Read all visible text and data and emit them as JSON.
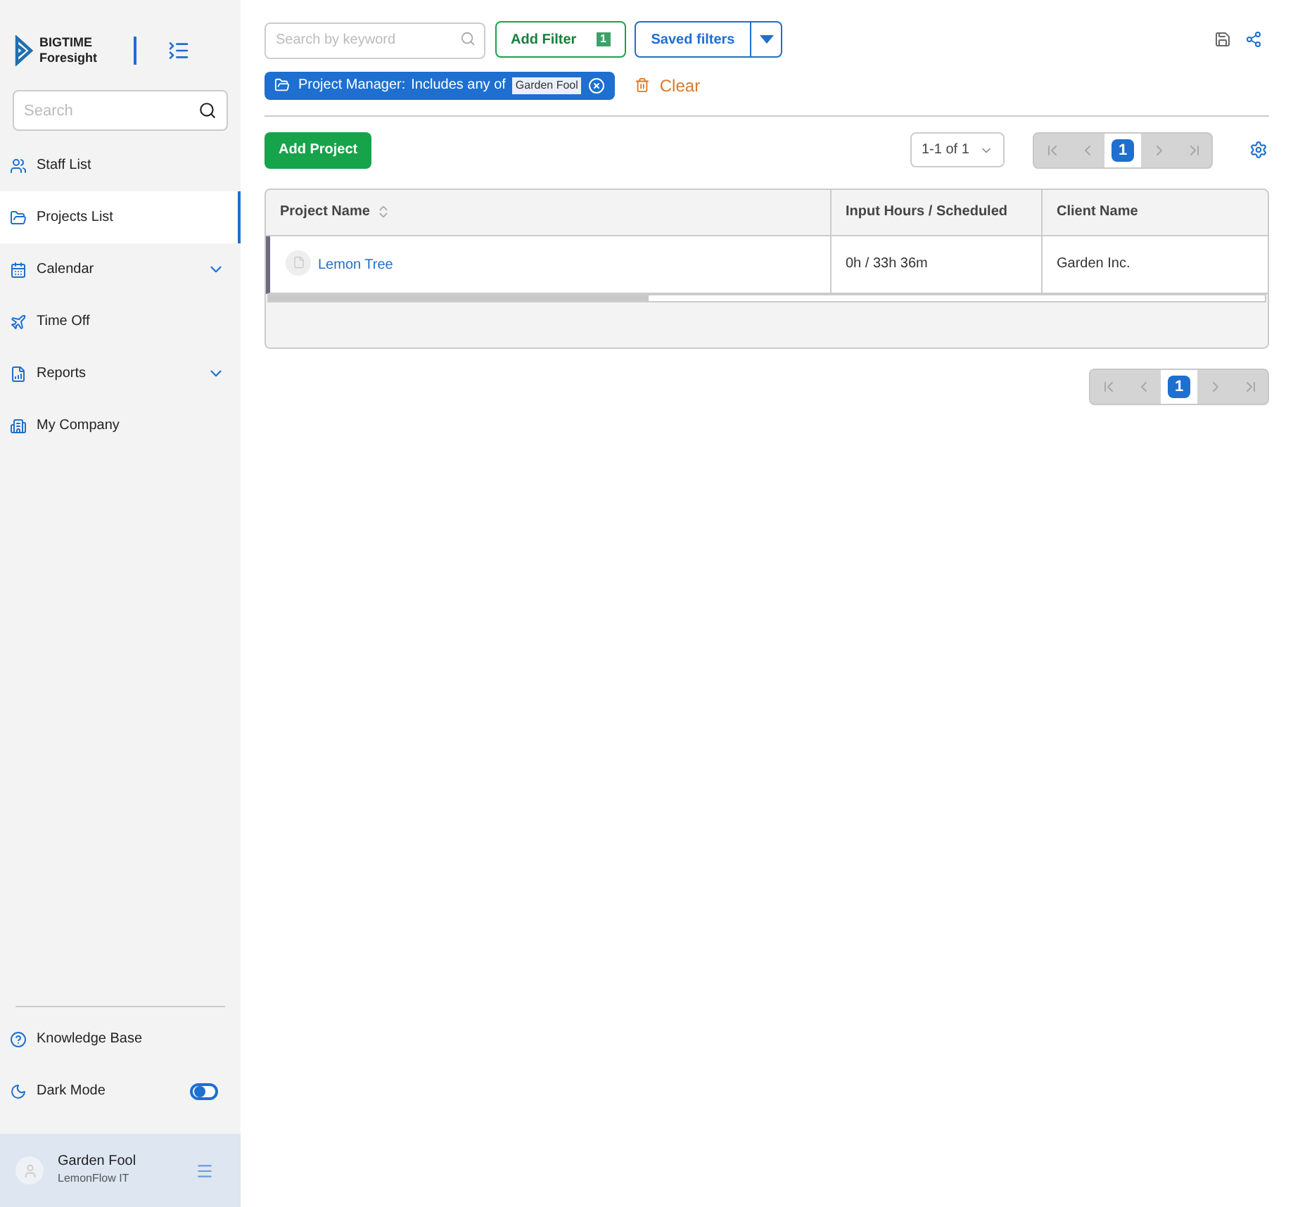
{
  "brand": {
    "line1": "BIGTIME",
    "line2": "Foresight"
  },
  "sidebar": {
    "search": {
      "placeholder": "Search"
    },
    "items": [
      {
        "label": "Staff List",
        "kind": "link",
        "selected": false
      },
      {
        "label": "Projects List",
        "kind": "link",
        "selected": true
      },
      {
        "label": "Calendar",
        "kind": "group",
        "selected": false
      },
      {
        "label": "Time Off",
        "kind": "link",
        "selected": false
      },
      {
        "label": "Reports",
        "kind": "group",
        "selected": false
      },
      {
        "label": "My Company",
        "kind": "link",
        "selected": false
      }
    ],
    "knowledge_base": "Knowledge Base",
    "dark_mode": {
      "label": "Dark Mode",
      "on": false
    },
    "user": {
      "name": "Garden Fool",
      "company": "LemonFlow IT"
    }
  },
  "toolbar": {
    "search": {
      "placeholder": "Search by keyword"
    },
    "add_filter": "Add Filter",
    "filter_count": "1",
    "saved_filters": "Saved filters"
  },
  "active_filter": {
    "field": "Project Manager:",
    "operator": "Includes any of",
    "value": "Garden Fool"
  },
  "clear": "Clear",
  "add_project": "Add Project",
  "range": "1-1 of 1",
  "pagers": [
    {
      "pages": [
        {
          "label": "1",
          "selected": true
        }
      ]
    },
    {
      "pages": [
        {
          "label": "1",
          "selected": true
        }
      ]
    }
  ],
  "table": {
    "columns": [
      "Project Name",
      "Input Hours / Scheduled",
      "Client Name"
    ],
    "rows": [
      {
        "project": "Lemon Tree",
        "hours": "0h / 33h 36m",
        "client": "Garden Inc."
      }
    ]
  }
}
